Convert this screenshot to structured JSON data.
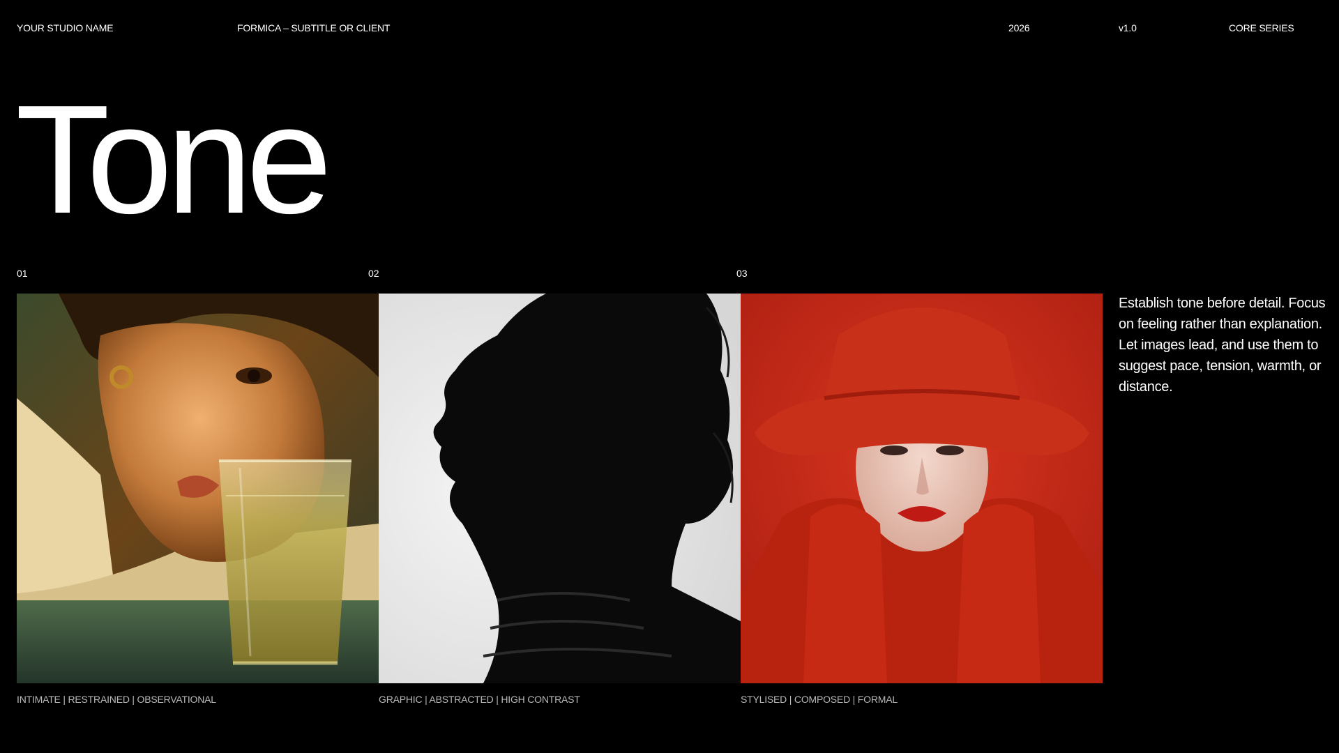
{
  "header": {
    "studio": "YOUR STUDIO NAME",
    "subtitle": "FORMICA – SUBTITLE OR CLIENT",
    "year": "2026",
    "version": "v1.0",
    "series": "CORE SERIES"
  },
  "title": "Tone",
  "panels": [
    {
      "number": "01",
      "caption": "INTIMATE | RESTRAINED | OBSERVATIONAL",
      "image": "warm-portrait-with-glass"
    },
    {
      "number": "02",
      "caption": "GRAPHIC | ABSTRACTED | HIGH CONTRAST",
      "image": "silhouette-profile"
    },
    {
      "number": "03",
      "caption": "STYLISED | COMPOSED | FORMAL",
      "image": "red-knit-hat-portrait"
    }
  ],
  "description": "Establish tone before detail. Focus on feeling rather than explanation. Let images lead, and use them to suggest pace, tension, warmth, or distance.",
  "colors": {
    "background": "#000000",
    "text": "#ffffff",
    "caption": "#b9b9b9",
    "accent_red": "#c0231a"
  }
}
